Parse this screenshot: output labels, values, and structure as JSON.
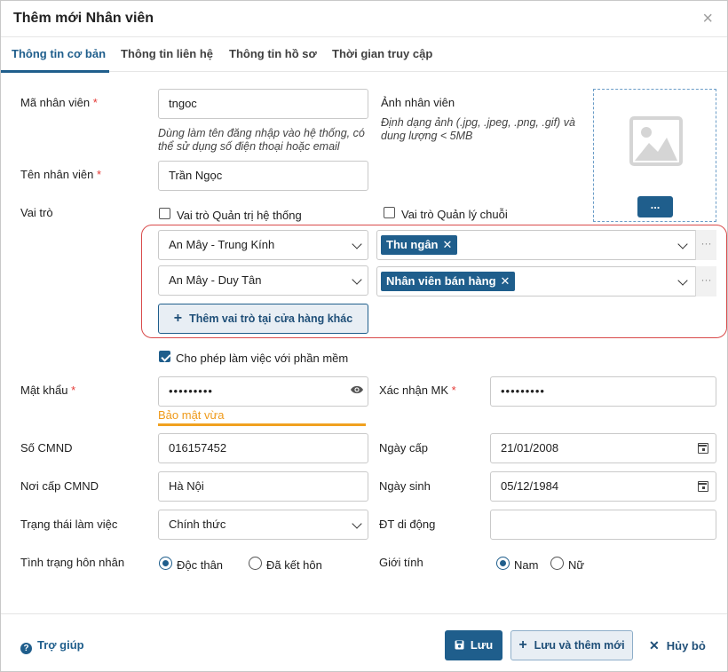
{
  "dialog": {
    "title": "Thêm mới Nhân viên",
    "close_glyph": "×"
  },
  "tabs": [
    {
      "label": "Thông tin cơ bản",
      "active": true
    },
    {
      "label": "Thông tin liên hệ"
    },
    {
      "label": "Thông tin hồ sơ"
    },
    {
      "label": "Thời gian truy cập"
    }
  ],
  "form": {
    "employee_code": {
      "label": "Mã nhân viên",
      "required_mark": "*",
      "value": "tngoc",
      "hint": "Dùng làm tên đăng nhập vào hệ thống, có thể sử dụng số điện thoại hoặc email"
    },
    "employee_name": {
      "label": "Tên nhân viên",
      "required_mark": "*",
      "value": "Trần Ngọc"
    },
    "photo": {
      "label": "Ảnh nhân viên",
      "hint": "Định dạng ảnh (.jpg, .jpeg, .png, .gif) và dung lượng < 5MB",
      "button": "..."
    },
    "role": {
      "label": "Vai trò",
      "admin_checkbox": {
        "label": "Vai trò Quản trị hệ thống",
        "checked": false
      },
      "chain_checkbox": {
        "label": "Vai trò Quản lý chuỗi",
        "checked": false
      },
      "rows": [
        {
          "store": "An Mây - Trung Kính",
          "tag": "Thu ngân",
          "more": "···"
        },
        {
          "store": "An Mây - Duy Tân",
          "tag": "Nhân viên bán hàng",
          "more": "···"
        }
      ],
      "add_button": "Thêm vai trò tại cửa hàng khác"
    },
    "allow_software": {
      "label": "Cho phép làm việc với phần mềm",
      "checked": true
    },
    "password": {
      "label": "Mật khẩu",
      "required_mark": "*",
      "value": "•••••••••",
      "strength": "Bảo mật vừa"
    },
    "confirm_password": {
      "label": "Xác nhận MK",
      "required_mark": "*",
      "value": "•••••••••"
    },
    "id_number": {
      "label": "Số CMND",
      "value": "016157452"
    },
    "issue_date": {
      "label": "Ngày cấp",
      "value": "21/01/2008"
    },
    "issue_place": {
      "label": "Nơi cấp CMND",
      "value": "Hà Nội"
    },
    "birth_date": {
      "label": "Ngày sinh",
      "value": "05/12/1984"
    },
    "work_status": {
      "label": "Trạng thái làm việc",
      "value": "Chính thức"
    },
    "mobile": {
      "label": "ĐT di động",
      "value": ""
    },
    "marital": {
      "label": "Tình trạng hôn nhân",
      "options": [
        "Độc thân",
        "Đã kết hôn"
      ],
      "selected": "Độc thân"
    },
    "gender": {
      "label": "Giới tính",
      "options": [
        "Nam",
        "Nữ"
      ],
      "selected": "Nam"
    }
  },
  "footer": {
    "help": "Trợ giúp",
    "save": "Lưu",
    "save_new": "Lưu và thêm mới",
    "cancel": "Hủy bỏ"
  },
  "colors": {
    "primary": "#1f5e8c",
    "highlight": "#d94a4a",
    "warning": "#f0a11f",
    "required": "#e53935"
  },
  "icons": [
    "close-icon",
    "image-placeholder-icon",
    "chevron-down-icon",
    "eye-icon",
    "calendar-icon",
    "help-icon",
    "save-icon",
    "plus-icon",
    "close-x-icon"
  ]
}
